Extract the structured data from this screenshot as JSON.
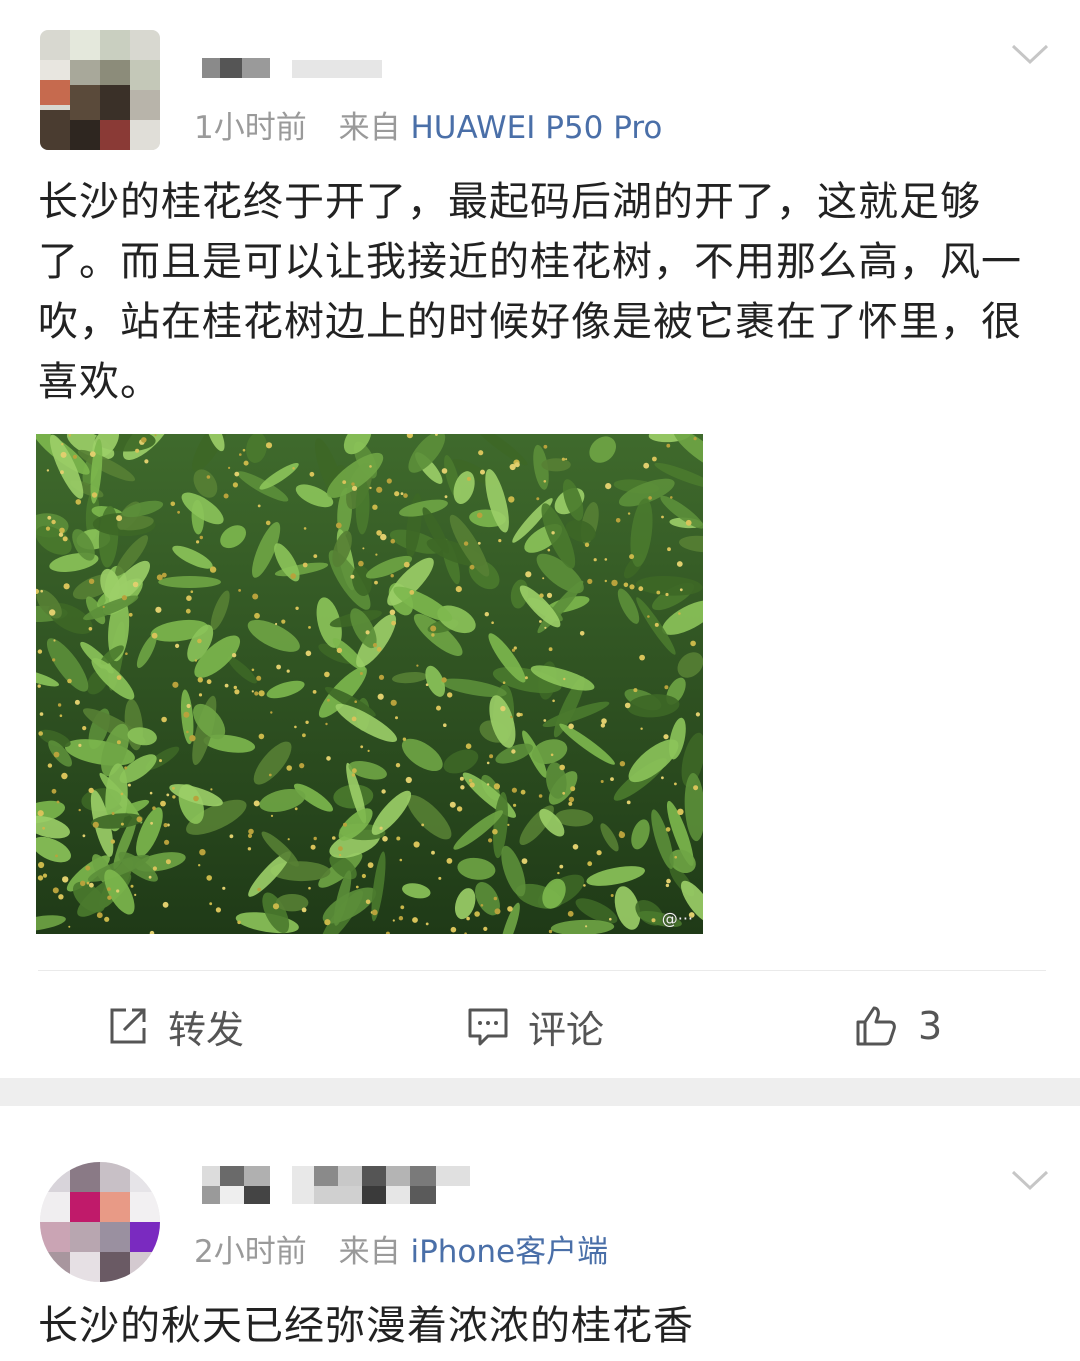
{
  "posts": [
    {
      "time": "1小时前",
      "source_prefix": "来自",
      "device": "HUAWEI P50 Pro",
      "text": "长沙的桂花终于开了，最起码后湖的开了，这就足够了。而且是可以让我接近的桂花树，不用那么高，风一吹，站在桂花树边上的时候好像是被它裹在了怀里，很喜欢。",
      "actions": {
        "repost_label": "转发",
        "comment_label": "评论",
        "like_count": "3"
      },
      "icons": [
        "chevron-down-icon",
        "repost-icon",
        "comment-icon",
        "like-icon"
      ]
    },
    {
      "time": "2小时前",
      "source_prefix": "来自",
      "device": "iPhone客户端",
      "text": "长沙的秋天已经弥漫着浓浓的桂花香"
    }
  ],
  "colors": {
    "accent_link": "#4a6fa8",
    "meta_gray": "#9a9a9a",
    "separator": "#eeeeee"
  }
}
